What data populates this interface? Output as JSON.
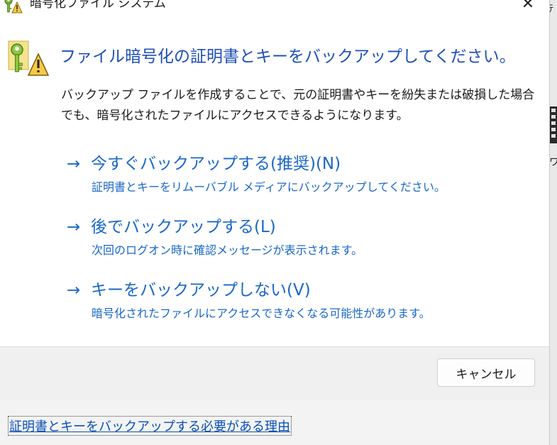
{
  "window": {
    "title": "暗号化ファイル システム",
    "close_label": "✕"
  },
  "dialog": {
    "heading": "ファイル暗号化の証明書とキーをバックアップしてください。",
    "description": "バックアップ ファイルを作成することで、元の証明書やキーを紛失または破損した場合でも、暗号化されたファイルにアクセスできるようになります。",
    "options": [
      {
        "arrow": "→",
        "title": "今すぐバックアップする(推奨)(N)",
        "subtitle": "証明書とキーをリムーバブル メディアにバックアップしてください。"
      },
      {
        "arrow": "→",
        "title": "後でバックアップする(L)",
        "subtitle": "次回のログオン時に確認メッセージが表示されます。"
      },
      {
        "arrow": "→",
        "title": "キーをバックアップしない(V)",
        "subtitle": "暗号化されたファイルにアクセスできなくなる可能性があります。"
      }
    ],
    "cancel_label": "キャンセル",
    "help_link": "証明書とキーをバックアップする必要がある理由"
  },
  "background": {
    "fragment_top": "ﾃ",
    "fragment_mid": "ワ"
  },
  "colors": {
    "heading": "#1f4fb8",
    "link": "#1a67c7",
    "footer": "#f0f0f0"
  },
  "icons": {
    "title": "key-warning-icon",
    "main": "key-warning-icon",
    "close": "close-icon"
  }
}
